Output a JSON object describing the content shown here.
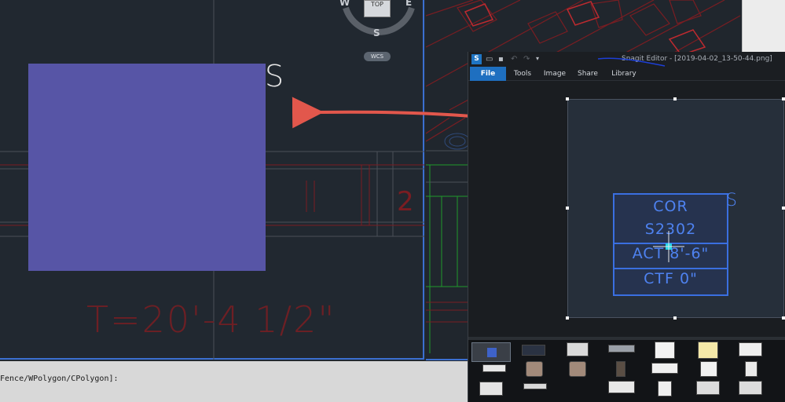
{
  "cad": {
    "viewcube": {
      "top_label": "TOP",
      "compass": {
        "west": "W",
        "east": "E",
        "south": "S"
      },
      "wcs_label": "WCS"
    },
    "s_letter": "S",
    "dimension_text": "T=20'-4 1/2\"",
    "command_line": "Fence/WPolygon/CPolygon]:",
    "colors": {
      "background": "#212830",
      "linework_red": "#7a1d22",
      "linework_green": "#1f9a2a",
      "viewport_border": "#3b6fd0",
      "redaction_block": "#5755a6",
      "annotation_arrow": "#e2574c"
    }
  },
  "snagit": {
    "title": "Snagit Editor - [2019-04-02_13-50-44.png]",
    "logo": "S",
    "toolbar_icons": [
      "open-icon",
      "save-icon",
      "undo-icon",
      "redo-icon",
      "more-icon"
    ],
    "menu": {
      "file": "File",
      "tools": "Tools",
      "image": "Image",
      "share": "Share",
      "library": "Library"
    },
    "capture": {
      "tag_lines": [
        "COR",
        "S2302",
        "ACT 8'-6\"",
        "CTF 0\""
      ],
      "tag_suffix": "S"
    }
  }
}
